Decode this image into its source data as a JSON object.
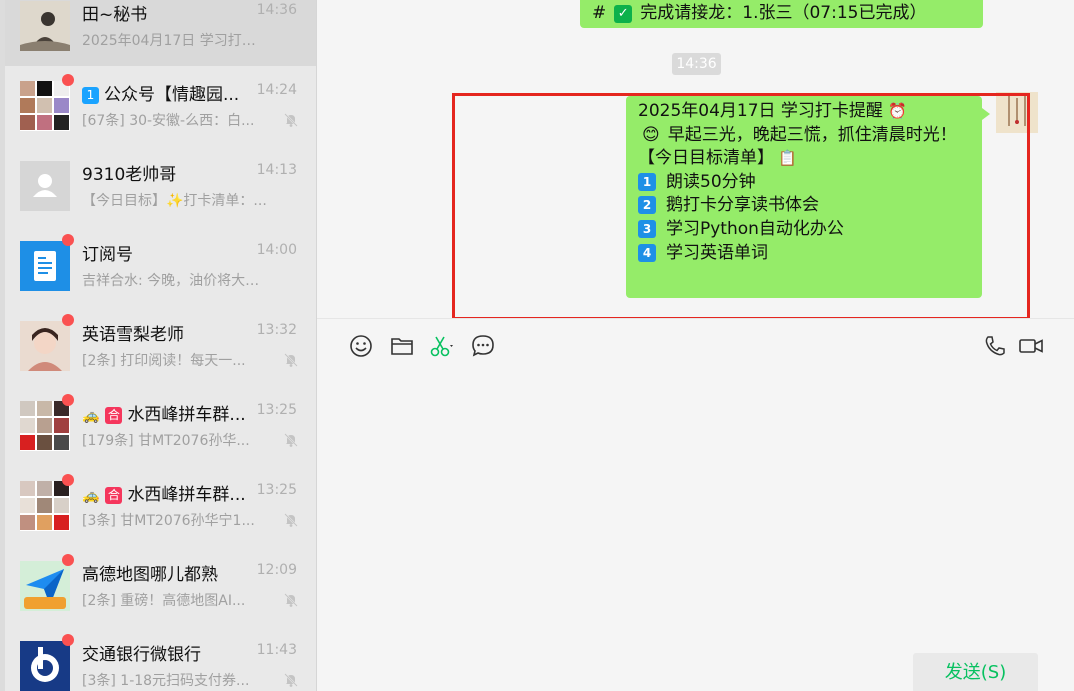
{
  "chat_list": [
    {
      "name": "田~秘书",
      "time": "14:36",
      "preview": "2025年04月17日 学习打卡...",
      "selected": true,
      "unread": false,
      "muted": false
    },
    {
      "name": "公众号【情趣园...",
      "badge": "1",
      "time": "14:24",
      "preview": "[67条] 30-安徽-么西：白...",
      "unread": true,
      "muted": true
    },
    {
      "name": "9310老帅哥",
      "time": "14:13",
      "preview": "【今日目标】✨打卡清单：...",
      "unread": false,
      "muted": false
    },
    {
      "name": "订阅号",
      "time": "14:00",
      "preview": "吉祥合水: 今晚，油价将大幅...",
      "unread": true,
      "muted": false
    },
    {
      "name": "英语雪梨老师",
      "time": "13:32",
      "preview": "[2条] 打印阅读！每天一...",
      "unread": true,
      "muted": true
    },
    {
      "name": "水西峰拼车群...",
      "badge_text": "合",
      "time": "13:25",
      "preview": "[179条] 甘MT2076孙华...",
      "unread": true,
      "muted": true
    },
    {
      "name": "水西峰拼车群...",
      "badge_text": "合",
      "time": "13:25",
      "preview": "[3条] 甘MT2076孙华宁1...",
      "unread": true,
      "muted": true
    },
    {
      "name": "高德地图哪儿都熟",
      "time": "12:09",
      "preview": "[2条] 重磅！高德地图AI...",
      "unread": true,
      "muted": true
    },
    {
      "name": "交通银行微银行",
      "time": "11:43",
      "preview": "[3条] 1-18元扫码支付券...",
      "unread": true,
      "muted": true
    }
  ],
  "chat": {
    "top_bubble_hash": "#",
    "top_bubble_text": "完成请接龙：1.张三（07:15已完成）",
    "timestamp": "14:36",
    "message": {
      "title": "2025年04月17日 学习打卡提醒",
      "line1": "早起三光，晚起三慌，抓住清晨时光！",
      "line2": "【今日目标清单】",
      "items": [
        {
          "num": "1",
          "text": "朗读50分钟"
        },
        {
          "num": "2",
          "text": "鹅打卡分享读书体会"
        },
        {
          "num": "3",
          "text": "学习Python自动化办公"
        },
        {
          "num": "4",
          "text": "学习英语单词"
        }
      ]
    }
  },
  "input": {
    "send_label": "发送(S)"
  },
  "colors": {
    "bubble_green": "#95ec69",
    "unread_red": "#fa5151",
    "highlight_red": "#e5261f",
    "send_green": "#07c160"
  }
}
